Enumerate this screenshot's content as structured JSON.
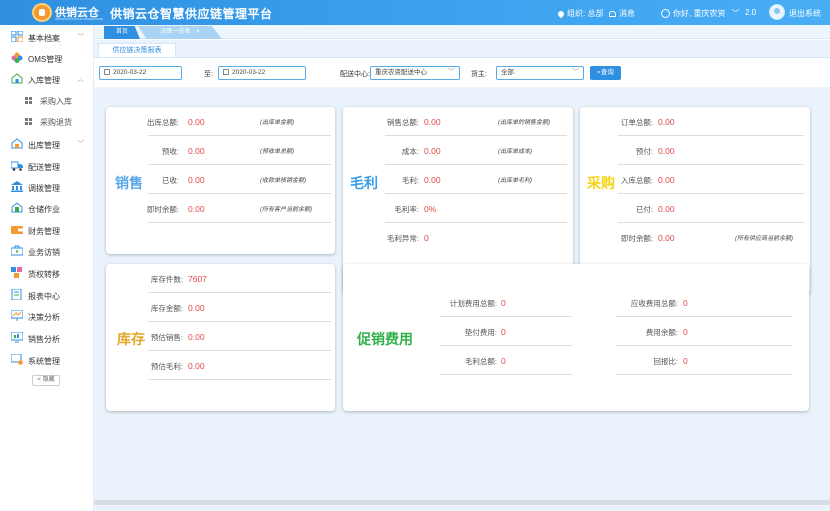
{
  "header": {
    "logo_text": "供销云仓",
    "logo_sub": "GONGXIAO CLOUD WAREHOUSE",
    "app_title": "供销云仓智慧供应链管理平台",
    "org": "组织: 总部",
    "messages": "消息",
    "greeting": "你好, 重庆农资",
    "version": "2.0",
    "logout": "退出系统"
  },
  "sidebar": {
    "items": [
      {
        "label": "基本档案",
        "chevron": "﹀"
      },
      {
        "label": "OMS管理",
        "chevron": ""
      },
      {
        "label": "入库管理",
        "chevron": "︿"
      },
      {
        "label": "出库管理",
        "chevron": "﹀"
      },
      {
        "label": "配送管理",
        "chevron": ""
      },
      {
        "label": "调拨管理",
        "chevron": ""
      },
      {
        "label": "仓储作业",
        "chevron": ""
      },
      {
        "label": "财务管理",
        "chevron": ""
      },
      {
        "label": "业务访销",
        "chevron": ""
      },
      {
        "label": "货权转移",
        "chevron": ""
      },
      {
        "label": "报表中心",
        "chevron": ""
      },
      {
        "label": "决策分析",
        "chevron": ""
      },
      {
        "label": "销售分析",
        "chevron": ""
      },
      {
        "label": "系统管理",
        "chevron": ""
      }
    ],
    "sub_items": [
      "采购入库",
      "采购退货"
    ],
    "collapse": "< 隐藏"
  },
  "tabs": {
    "home": "首页",
    "active": "决策一览表",
    "close": "×"
  },
  "page": {
    "subtab": "供应链决策报表"
  },
  "filters": {
    "date_from": "2020-03-22",
    "to_label": "至:",
    "date_to": "2020-03-22",
    "center_label": "配送中心:",
    "center_value": "重庆农资配送中心",
    "owner_label": "货主:",
    "owner_value": "全部",
    "query": "查询"
  },
  "cards": {
    "sales": {
      "title": "销售",
      "rows": [
        {
          "label": "出库总额:",
          "value": "0.00",
          "note": "(出库单金额)"
        },
        {
          "label": "预收:",
          "value": "0.00",
          "note": "(预收单总额)"
        },
        {
          "label": "已收:",
          "value": "0.00",
          "note": "(收款单核销金额)"
        },
        {
          "label": "即时余额:",
          "value": "0.00",
          "note": "(所有客户当前余额)"
        }
      ]
    },
    "gross": {
      "title": "毛利",
      "rows": [
        {
          "label": "销售总额:",
          "value": "0.00",
          "note": "(出库单的销售金额)"
        },
        {
          "label": "成本:",
          "value": "0.00",
          "note": "(出库单成本)"
        },
        {
          "label": "毛利:",
          "value": "0.00",
          "note": "(出库单毛利)"
        },
        {
          "label": "毛利率:",
          "value": "0%",
          "note": ""
        },
        {
          "label": "毛利异常:",
          "value": "0",
          "note": ""
        }
      ]
    },
    "purchase": {
      "title": "采购",
      "rows": [
        {
          "label": "订单总额:",
          "value": "0.00",
          "note": ""
        },
        {
          "label": "预付:",
          "value": "0.00",
          "note": ""
        },
        {
          "label": "入库总额:",
          "value": "0.00",
          "note": ""
        },
        {
          "label": "已付:",
          "value": "0.00",
          "note": ""
        },
        {
          "label": "即时余额:",
          "value": "0.00",
          "note": "(所有供应商当前余额)"
        }
      ]
    },
    "stock": {
      "title": "库存",
      "rows": [
        {
          "label": "库存件数:",
          "value": "7607"
        },
        {
          "label": "库存金额:",
          "value": "0.00"
        },
        {
          "label": "预估销售:",
          "value": "0.00"
        },
        {
          "label": "预估毛利:",
          "value": "0.00"
        }
      ]
    },
    "promo": {
      "title": "促销费用",
      "left": [
        {
          "label": "计划费用总额:",
          "value": "0"
        },
        {
          "label": "垫付费用:",
          "value": "0"
        },
        {
          "label": "毛利总额:",
          "value": "0"
        }
      ],
      "right": [
        {
          "label": "应收费用总额:",
          "value": "0"
        },
        {
          "label": "费用余额:",
          "value": "0"
        },
        {
          "label": "回报比:",
          "value": "0"
        }
      ]
    }
  },
  "colors": {
    "header_blue": "#2f8fe0",
    "sales_title": "#5aa8e8",
    "gross_title": "#3a9ee6",
    "purchase_title": "#f5d316",
    "stock_title": "#e3a72a",
    "promo_title": "#33b04a",
    "value_red": "#e04a4a"
  }
}
